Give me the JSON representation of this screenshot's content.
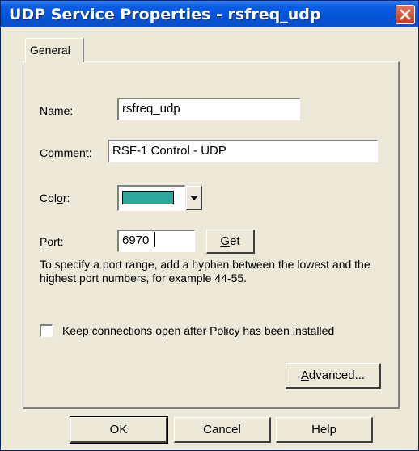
{
  "window": {
    "title": "UDP Service Properties - rsfreq_udp",
    "close_icon": "close-icon"
  },
  "tabs": [
    {
      "label": "General",
      "selected": true
    }
  ],
  "form": {
    "name": {
      "label_prefix": "",
      "label_access": "N",
      "label_rest": "ame:",
      "value": "rsfreq_udp"
    },
    "comment": {
      "label_access": "C",
      "label_rest": "omment:",
      "value": "RSF-1 Control - UDP"
    },
    "color": {
      "label_pre": "Col",
      "label_access": "o",
      "label_rest": "r:",
      "value": "#2aa89a"
    },
    "port": {
      "label_access": "P",
      "label_rest": "ort:",
      "value": "6970"
    },
    "get_button": {
      "access": "G",
      "rest": "et"
    },
    "help_text": "To specify a port range, add a hyphen between the lowest and the highest port numbers, for example 44-55.",
    "keep_connections": {
      "label": "Keep connections open after Policy has been installed",
      "checked": false
    },
    "advanced_button": {
      "access": "A",
      "rest": "dvanced..."
    }
  },
  "buttons": {
    "ok": "OK",
    "cancel": "Cancel",
    "help": "Help"
  },
  "colors": {
    "titlebar": "#0453d7",
    "dialog_bg": "#ece9d8",
    "close": "#d84f32",
    "selected_color": "#2aa89a"
  }
}
